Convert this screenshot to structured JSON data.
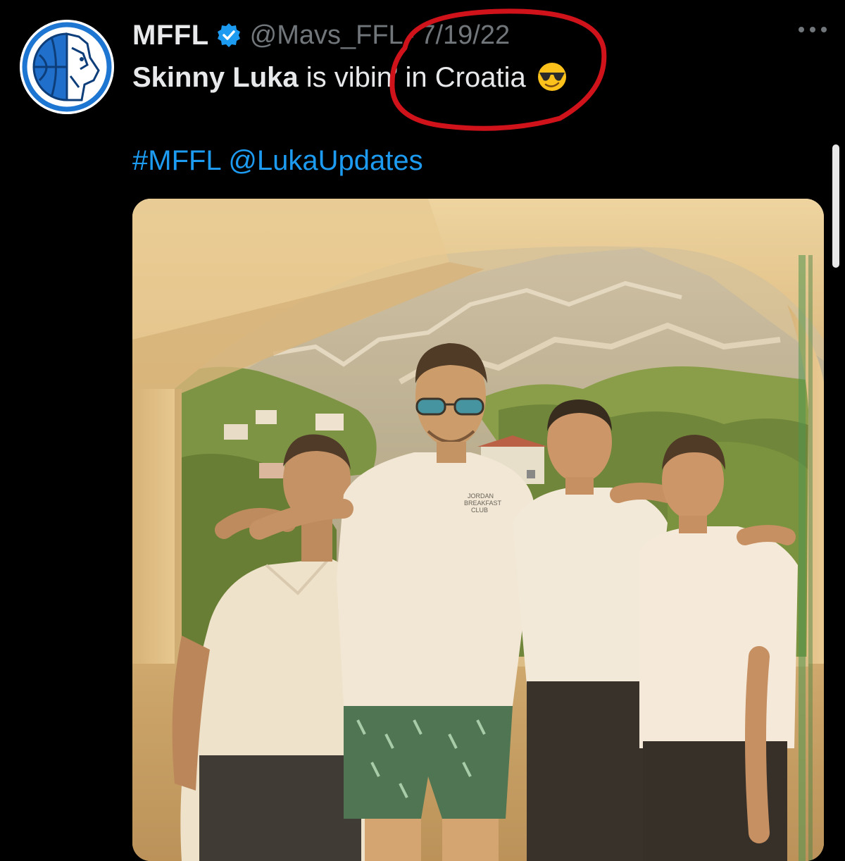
{
  "tweet": {
    "display_name": "MFFL",
    "handle": "@Mavs_FFL",
    "separator": "·",
    "date": "7/19/22",
    "text_bold": "Skinny Luka",
    "text_rest": " is vibin’ in Croatia",
    "hashtag": "#MFFL",
    "mention": "@LukaUpdates",
    "emoji": "smiling-face-with-sunglasses"
  },
  "media": {
    "shirt_print": [
      "JORDAN",
      "BREAKFAST",
      "CLUB"
    ]
  },
  "colors": {
    "background": "#000000",
    "text_primary": "#e7e9ea",
    "text_secondary": "#71767b",
    "link": "#1d9bf0",
    "verified": "#1d9bf0",
    "annotation": "#d0121b"
  },
  "icons": {
    "verified": "verified-badge-icon",
    "more": "more-options-icon",
    "avatar": "mavericks-horse-logo"
  }
}
